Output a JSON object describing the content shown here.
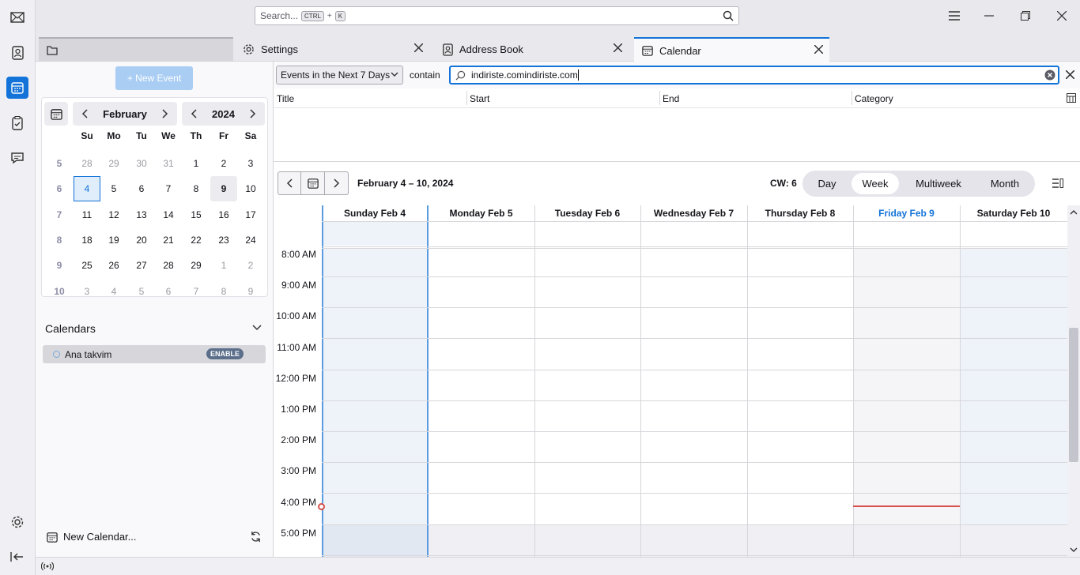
{
  "app": {
    "search_placeholder": "Search...",
    "kbd_ctrl": "CTRL",
    "kbd_plus": "+",
    "kbd_k": "K"
  },
  "spaces": [
    "mail-icon",
    "address-book-icon",
    "calendar-icon",
    "tasks-icon",
    "chat-icon",
    "settings-icon",
    "collapse-icon"
  ],
  "tabs": [
    {
      "label": ""
    },
    {
      "label": "Settings"
    },
    {
      "label": "Address Book"
    },
    {
      "label": "Calendar"
    }
  ],
  "left": {
    "new_event": "+ New Event",
    "month": "February",
    "year": "2024",
    "weekday_headers": [
      "Su",
      "Mo",
      "Tu",
      "We",
      "Th",
      "Fr",
      "Sa"
    ],
    "weeks": [
      {
        "wk": "5",
        "days": [
          "28",
          "29",
          "30",
          "31",
          "1",
          "2",
          "3"
        ]
      },
      {
        "wk": "6",
        "days": [
          "4",
          "5",
          "6",
          "7",
          "8",
          "9",
          "10"
        ]
      },
      {
        "wk": "7",
        "days": [
          "11",
          "12",
          "13",
          "14",
          "15",
          "16",
          "17"
        ]
      },
      {
        "wk": "8",
        "days": [
          "18",
          "19",
          "20",
          "21",
          "22",
          "23",
          "24"
        ]
      },
      {
        "wk": "9",
        "days": [
          "25",
          "26",
          "27",
          "28",
          "29",
          "1",
          "2"
        ]
      },
      {
        "wk": "10",
        "days": [
          "3",
          "4",
          "5",
          "6",
          "7",
          "8",
          "9"
        ]
      }
    ],
    "calendars_title": "Calendars",
    "calendar_name": "Ana takvim",
    "enable": "ENABLE",
    "new_calendar": "New Calendar..."
  },
  "filter": {
    "select": "Events in the Next 7 Days",
    "contain": "contain",
    "value": "indiriste.comindiriste.com"
  },
  "list": {
    "cols": [
      "Title",
      "Start",
      "End",
      "Category"
    ]
  },
  "view": {
    "range": "February 4 – 10, 2024",
    "cw": "CW: 6",
    "tabs": [
      "Day",
      "Week",
      "Multiweek",
      "Month"
    ],
    "selected": "Week"
  },
  "grid": {
    "days": [
      "Sunday Feb 4",
      "Monday Feb 5",
      "Tuesday Feb 6",
      "Wednesday Feb 7",
      "Thursday Feb 8",
      "Friday Feb 9",
      "Saturday Feb 10"
    ],
    "times": [
      "8:00 AM",
      "9:00 AM",
      "10:00 AM",
      "11:00 AM",
      "12:00 PM",
      "1:00 PM",
      "2:00 PM",
      "3:00 PM",
      "4:00 PM",
      "5:00 PM"
    ],
    "today_color": "#1373d9",
    "now_color": "#d7504b"
  }
}
